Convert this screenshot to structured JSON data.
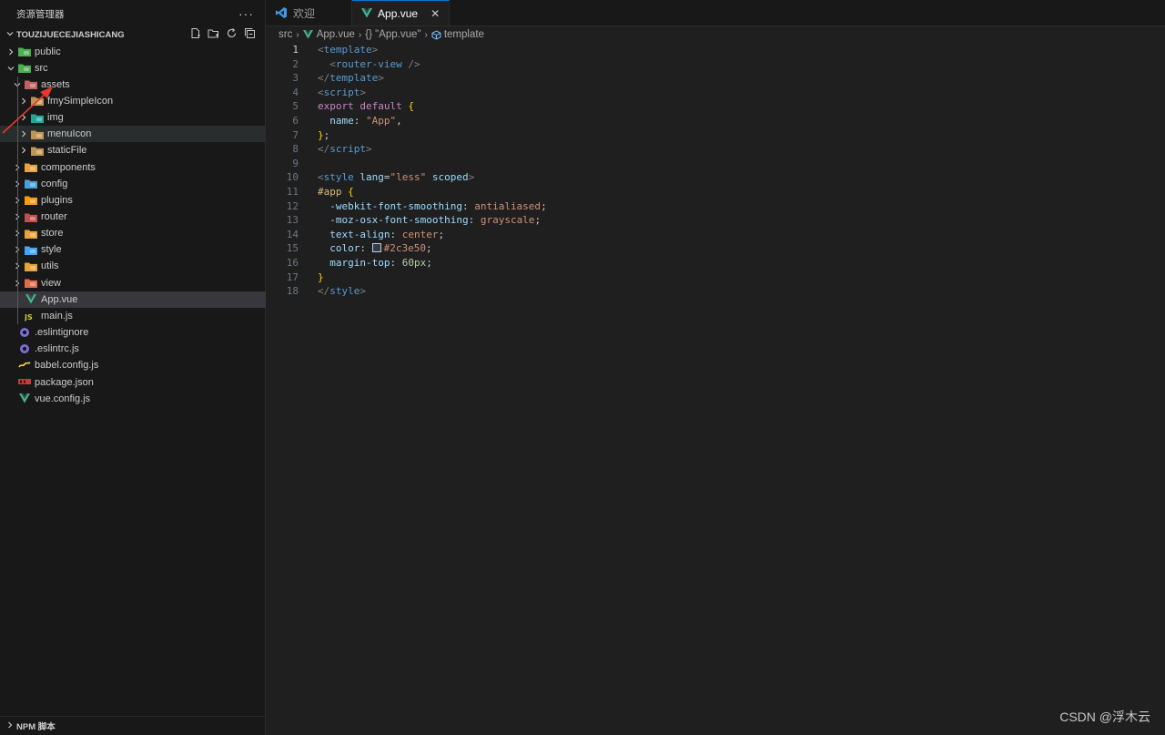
{
  "sidebar": {
    "title": "资源管理器",
    "more": "···",
    "project": "TOUZIJUECEJIASHICANG",
    "tree": [
      {
        "label": "public",
        "kind": "folder",
        "twisty": "›",
        "icon": "public-folder-icon",
        "color": "#4caf50"
      },
      {
        "label": "src",
        "kind": "folder",
        "twisty": "⌄",
        "icon": "src-folder-icon",
        "color": "#4caf50"
      },
      {
        "label": "assets",
        "kind": "folder",
        "twisty": "⌄",
        "icon": "assets-folder-icon",
        "color": "#c06060"
      },
      {
        "label": "fmySimpleIcon",
        "kind": "folder",
        "twisty": "›",
        "icon": "folder-icon",
        "color": "#c09553"
      },
      {
        "label": "img",
        "kind": "folder",
        "twisty": "›",
        "icon": "image-folder-icon",
        "color": "#26a69a"
      },
      {
        "label": "menuIcon",
        "kind": "folder",
        "twisty": "›",
        "icon": "folder-icon",
        "color": "#c09553"
      },
      {
        "label": "staticFile",
        "kind": "folder",
        "twisty": "›",
        "icon": "folder-icon",
        "color": "#c09553"
      },
      {
        "label": "components",
        "kind": "folder",
        "twisty": "›",
        "icon": "components-folder-icon",
        "color": "#e8a33d"
      },
      {
        "label": "config",
        "kind": "folder",
        "twisty": "›",
        "icon": "config-folder-icon",
        "color": "#4a9fd8"
      },
      {
        "label": "plugins",
        "kind": "folder",
        "twisty": "›",
        "icon": "plugins-folder-icon",
        "color": "#f39c12"
      },
      {
        "label": "router",
        "kind": "folder",
        "twisty": "›",
        "icon": "router-folder-icon",
        "color": "#c0504d"
      },
      {
        "label": "store",
        "kind": "folder",
        "twisty": "›",
        "icon": "store-folder-icon",
        "color": "#e8a33d"
      },
      {
        "label": "style",
        "kind": "folder",
        "twisty": "›",
        "icon": "style-folder-icon",
        "color": "#42a5f5"
      },
      {
        "label": "utils",
        "kind": "folder",
        "twisty": "›",
        "icon": "utils-folder-icon",
        "color": "#e8a33d"
      },
      {
        "label": "view",
        "kind": "folder",
        "twisty": "›",
        "icon": "view-folder-icon",
        "color": "#e06c4c"
      },
      {
        "label": "App.vue",
        "kind": "file",
        "twisty": "",
        "icon": "vue-icon",
        "color": "#41b883"
      },
      {
        "label": "main.js",
        "kind": "file",
        "twisty": "",
        "icon": "js-icon",
        "color": "#cbcb41"
      },
      {
        "label": ".eslintignore",
        "kind": "file",
        "twisty": "",
        "icon": "eslint-icon",
        "color": "#7b6fdb"
      },
      {
        "label": ".eslintrc.js",
        "kind": "file",
        "twisty": "",
        "icon": "eslint-icon",
        "color": "#7b6fdb"
      },
      {
        "label": "babel.config.js",
        "kind": "file",
        "twisty": "",
        "icon": "babel-icon",
        "color": "#f5da55"
      },
      {
        "label": "package.json",
        "kind": "file",
        "twisty": "",
        "icon": "npm-icon",
        "color": "#cb3837"
      },
      {
        "label": "vue.config.js",
        "kind": "file",
        "twisty": "",
        "icon": "vue-icon",
        "color": "#41b883"
      }
    ],
    "npm_section": "NPM 脚本"
  },
  "tabs": [
    {
      "label": "欢迎",
      "icon": "vscode-icon",
      "active": false
    },
    {
      "label": "App.vue",
      "icon": "vue-icon",
      "active": true,
      "close": "✕"
    }
  ],
  "breadcrumb": {
    "items": [
      "src",
      "App.vue",
      "{} \"App.vue\"",
      "template"
    ],
    "sep": "›"
  },
  "code": {
    "line_numbers": [
      "1",
      "2",
      "3",
      "4",
      "5",
      "6",
      "7",
      "8",
      "9",
      "10",
      "11",
      "12",
      "13",
      "14",
      "15",
      "16",
      "17",
      "18"
    ],
    "current_line": 1
  },
  "watermark": "CSDN @浮木云",
  "colors": {
    "accent": "#0078d4",
    "annotation_arrow": "#e8372c"
  }
}
